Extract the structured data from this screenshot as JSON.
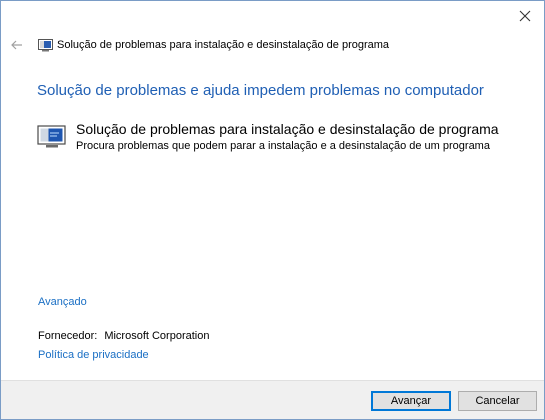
{
  "window": {
    "close_icon": "close-icon"
  },
  "header": {
    "back_icon": "back-arrow-icon",
    "app_icon": "troubleshooter-icon",
    "title": "Solução de problemas para instalação e desinstalação de programa"
  },
  "main": {
    "heading": "Solução de problemas e ajuda impedem problemas no computador",
    "tool": {
      "icon": "troubleshooter-icon",
      "title": "Solução de problemas para instalação e desinstalação de programa",
      "description": "Procura problemas que podem parar a instalação e a desinstalação de um programa"
    },
    "advanced_link": "Avançado",
    "publisher_label": "Fornecedor:",
    "publisher_value": "Microsoft Corporation",
    "privacy_link": "Política de privacidade"
  },
  "footer": {
    "next_label": "Avançar",
    "cancel_label": "Cancelar"
  },
  "colors": {
    "accent": "#1f5fb4",
    "link": "#1a6fc4",
    "footer_bg": "#f0f0f0",
    "default_button_border": "#0078d7"
  }
}
